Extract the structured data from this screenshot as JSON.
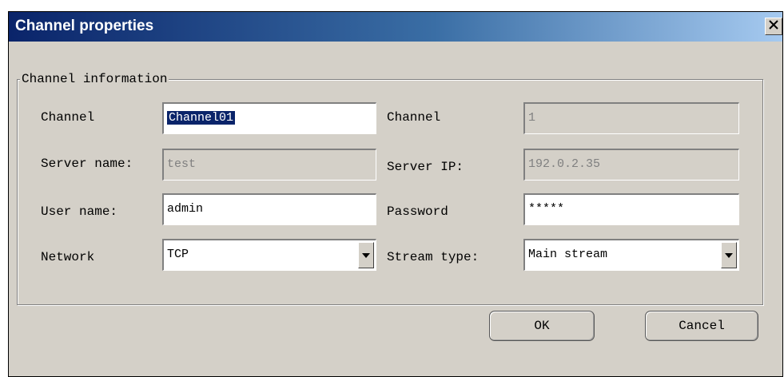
{
  "window": {
    "title": "Channel properties",
    "close_symbol": "✕"
  },
  "group": {
    "legend": "Channel information"
  },
  "fields": {
    "channel_name": {
      "label": "Channel",
      "value": "Channel01"
    },
    "channel_number": {
      "label": "Channel",
      "value": "1"
    },
    "server_name": {
      "label": "Server name:",
      "value": "test"
    },
    "server_ip": {
      "label": "Server IP:",
      "value": "192.0.2.35"
    },
    "user_name": {
      "label": "User name:",
      "value": "admin"
    },
    "password": {
      "label": "Password",
      "value": "*****"
    },
    "network": {
      "label": "Network",
      "value": "TCP"
    },
    "stream_type": {
      "label": "Stream type:",
      "value": "Main stream"
    }
  },
  "buttons": {
    "ok": "OK",
    "cancel": "Cancel"
  },
  "colors": {
    "titlebar_start": "#0a246a",
    "titlebar_end": "#a6caf0",
    "dialog_bg": "#d4d0c8",
    "selection": "#0a246a"
  }
}
